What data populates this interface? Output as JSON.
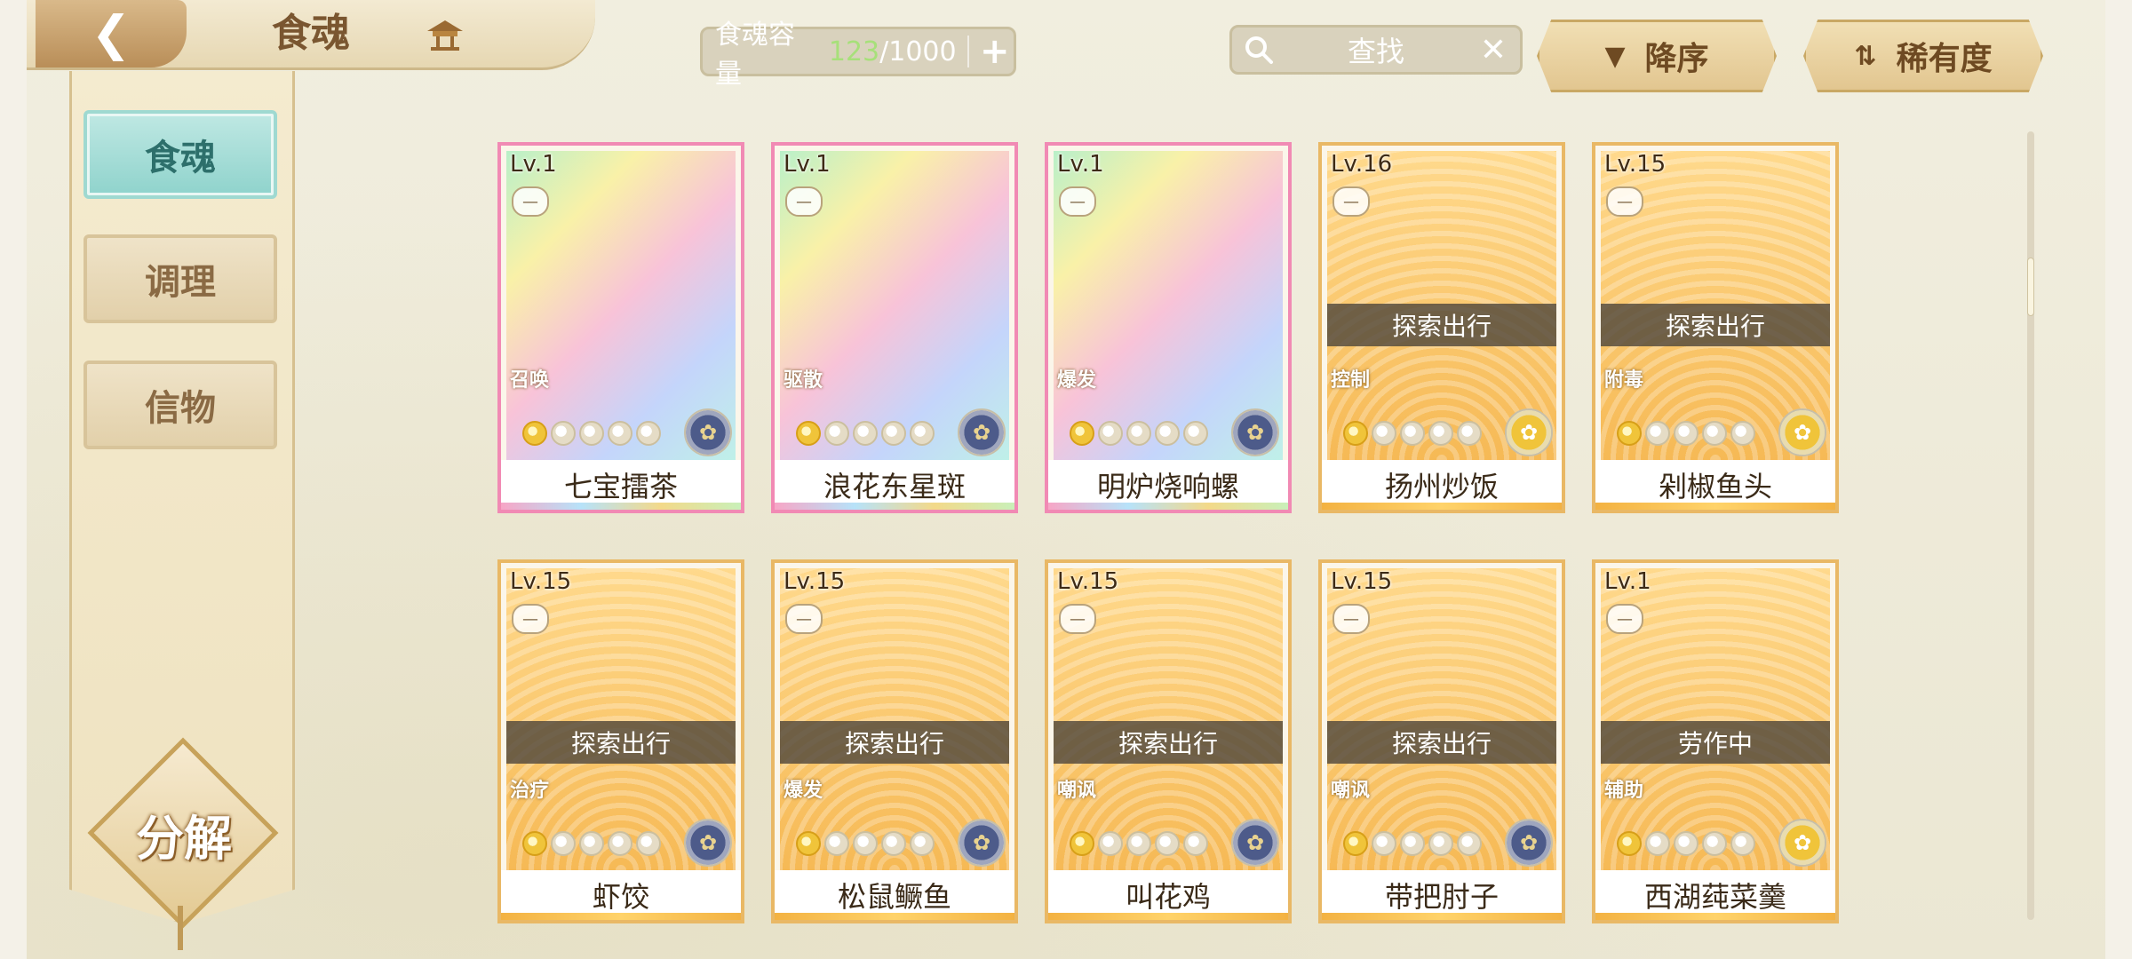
{
  "header": {
    "title": "食魂",
    "back_icon": "back-arrow-icon",
    "home_icon": "pavilion-home-icon"
  },
  "capacity": {
    "label": "食魂容量",
    "used": "123",
    "total": "/1000",
    "add_icon": "plus-icon"
  },
  "search": {
    "placeholder": "查找",
    "clear": "✕"
  },
  "sort": {
    "order_label": "降序",
    "rarity_label": "稀有度"
  },
  "sidebar": {
    "items": [
      {
        "label": "食魂",
        "active": true
      },
      {
        "label": "调理",
        "active": false
      },
      {
        "label": "信物",
        "active": false
      }
    ],
    "decompose_label": "分解"
  },
  "cards": [
    {
      "name": "七宝擂茶",
      "level": "Lv.1",
      "role": "召唤",
      "status": "",
      "stars": 1,
      "frame": "rainbow",
      "medal": "blue"
    },
    {
      "name": "浪花东星斑",
      "level": "Lv.1",
      "role": "驱散",
      "status": "",
      "stars": 1,
      "frame": "rainbow",
      "medal": "blue"
    },
    {
      "name": "明炉烧响螺",
      "level": "Lv.1",
      "role": "爆发",
      "status": "",
      "stars": 1,
      "frame": "rainbow",
      "medal": "blue"
    },
    {
      "name": "扬州炒饭",
      "level": "Lv.16",
      "role": "控制",
      "status": "探索出行",
      "stars": 1,
      "frame": "gold",
      "medal": "gold"
    },
    {
      "name": "剁椒鱼头",
      "level": "Lv.15",
      "role": "附毒",
      "status": "探索出行",
      "stars": 1,
      "frame": "gold",
      "medal": "gold"
    },
    {
      "name": "虾饺",
      "level": "Lv.15",
      "role": "治疗",
      "status": "探索出行",
      "stars": 1,
      "frame": "gold",
      "medal": "blue"
    },
    {
      "name": "松鼠鳜鱼",
      "level": "Lv.15",
      "role": "爆发",
      "status": "探索出行",
      "stars": 1,
      "frame": "gold",
      "medal": "blue"
    },
    {
      "name": "叫花鸡",
      "level": "Lv.15",
      "role": "嘲讽",
      "status": "探索出行",
      "stars": 1,
      "frame": "gold",
      "medal": "blue"
    },
    {
      "name": "带把肘子",
      "level": "Lv.15",
      "role": "嘲讽",
      "status": "探索出行",
      "stars": 1,
      "frame": "gold",
      "medal": "blue"
    },
    {
      "name": "西湖莼菜羹",
      "level": "Lv.1",
      "role": "辅助",
      "status": "劳作中",
      "stars": 1,
      "frame": "gold",
      "medal": "gold"
    }
  ]
}
